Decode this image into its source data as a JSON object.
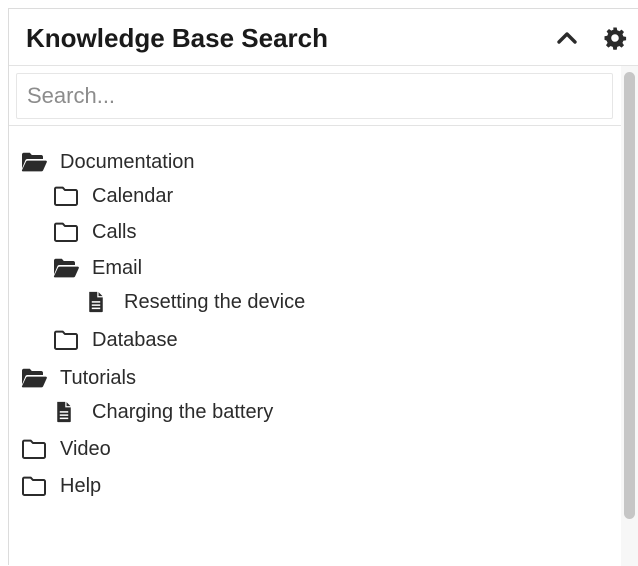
{
  "header": {
    "title": "Knowledge Base Search"
  },
  "search": {
    "placeholder": "Search..."
  },
  "tree": {
    "documentation": "Documentation",
    "calendar": "Calendar",
    "calls": "Calls",
    "email": "Email",
    "resetting": "Resetting the device",
    "database": "Database",
    "tutorials": "Tutorials",
    "charging": "Charging the battery",
    "video": "Video",
    "help": "Help"
  },
  "icons": {
    "collapse": "chevron-up-icon",
    "settings": "gear-icon",
    "folder_open": "folder-open-icon",
    "folder_closed": "folder-icon",
    "file": "file-text-icon"
  },
  "colors": {
    "icon": "#2b2b2b",
    "scroll_thumb": "#c6c6c6"
  }
}
